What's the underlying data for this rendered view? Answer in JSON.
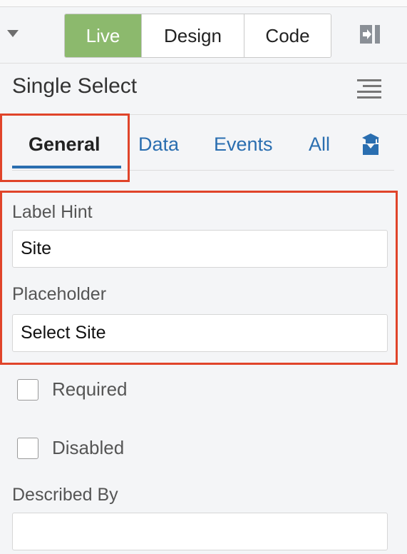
{
  "toolbar": {
    "modes": [
      {
        "label": "Live"
      },
      {
        "label": "Design"
      },
      {
        "label": "Code"
      }
    ],
    "active_mode": "Live",
    "active_color": "#8cb96d"
  },
  "panel": {
    "title": "Single Select"
  },
  "tabs": [
    {
      "label": "General",
      "active": true
    },
    {
      "label": "Data",
      "active": false
    },
    {
      "label": "Events",
      "active": false
    },
    {
      "label": "All",
      "active": false
    }
  ],
  "fields": {
    "label_hint": {
      "label": "Label Hint",
      "value": "Site"
    },
    "placeholder": {
      "label": "Placeholder",
      "value": "Select Site"
    },
    "required": {
      "label": "Required",
      "checked": false
    },
    "disabled": {
      "label": "Disabled",
      "checked": false
    },
    "described_by": {
      "label": "Described By",
      "value": ""
    }
  },
  "icons": {
    "collapse": "caret-down-icon",
    "panel_toggle": "panel-toggle-icon",
    "menu": "hamburger-menu-icon",
    "tab_extra": "graduation-icon"
  },
  "colors": {
    "link": "#2a6eb0",
    "highlight": "#e0442a"
  }
}
